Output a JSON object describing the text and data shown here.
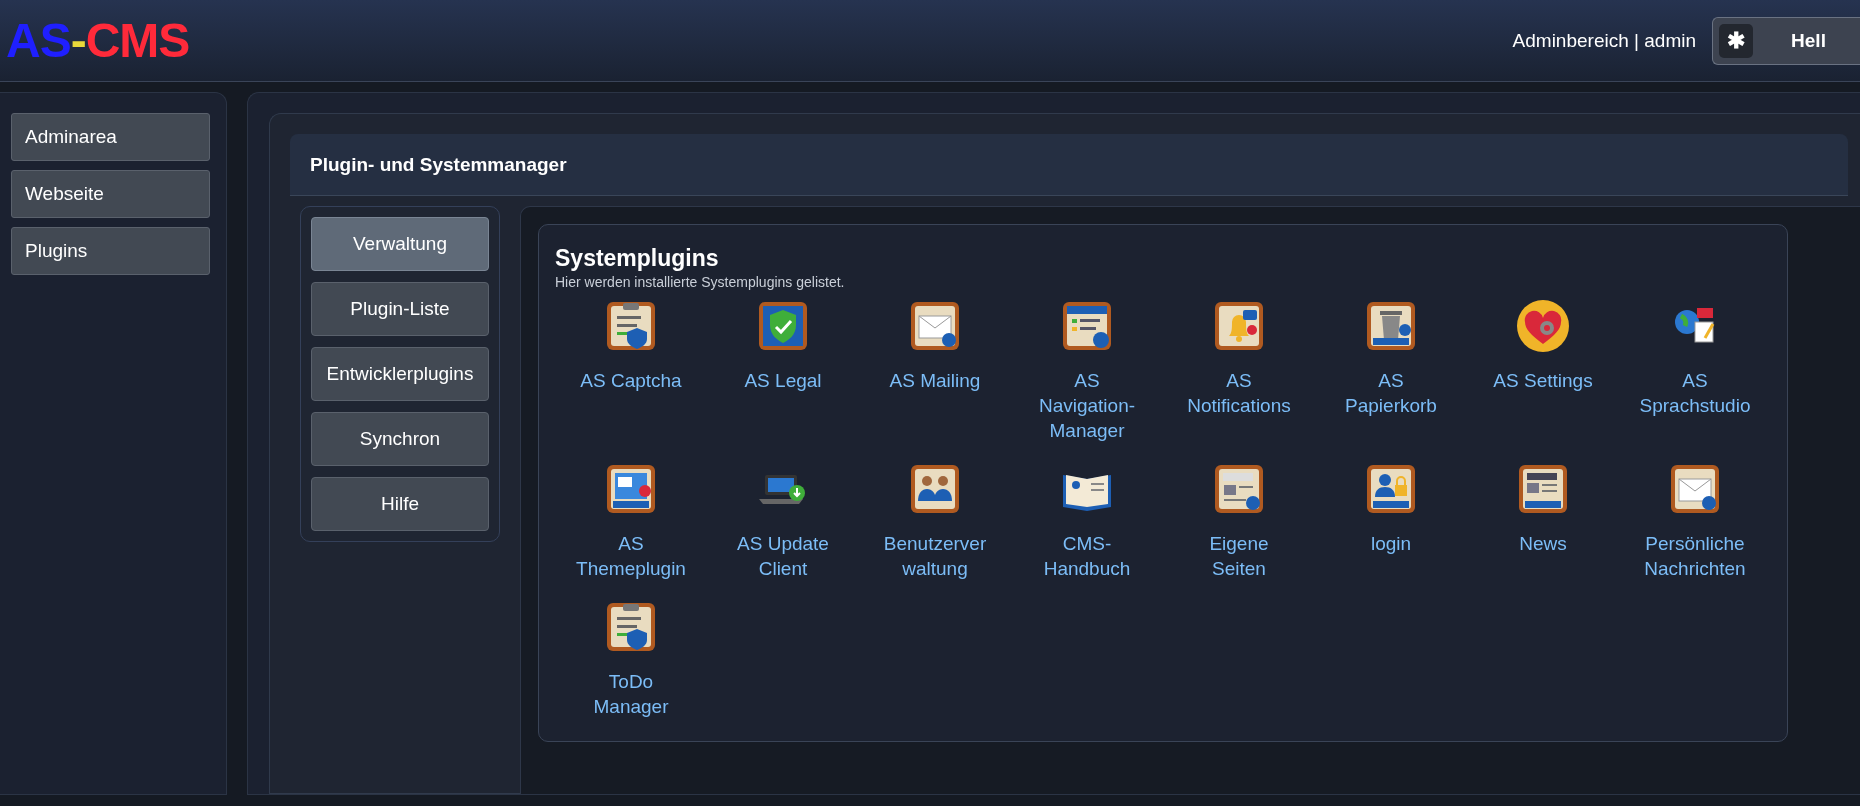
{
  "header": {
    "logo": [
      {
        "text": "AS",
        "color": "#1f1fff"
      },
      {
        "text": "-",
        "color": "#e8d83a"
      },
      {
        "text": "CMS",
        "color": "#ff2a3a"
      }
    ],
    "user_label": "Adminbereich | admin",
    "theme_toggle": {
      "icon": "✱",
      "label": "Hell"
    }
  },
  "sidebar": {
    "items": [
      {
        "label": "Adminarea"
      },
      {
        "label": "Webseite"
      },
      {
        "label": "Plugins"
      }
    ]
  },
  "manager": {
    "title": "Plugin- und Systemmanager",
    "menu": [
      {
        "label": "Verwaltung",
        "selected": true
      },
      {
        "label": "Plugin-Liste",
        "selected": false
      },
      {
        "label": "Entwicklerplugins",
        "selected": false
      },
      {
        "label": "Synchron",
        "selected": false
      },
      {
        "label": "Hilfe",
        "selected": false
      }
    ],
    "section": {
      "title": "Systemplugins",
      "subtitle": "Hier werden installierte Systemplugins gelistet.",
      "plugins": [
        {
          "name": "AS Captcha",
          "kind": "clipboard"
        },
        {
          "name": "AS Legal",
          "kind": "shield"
        },
        {
          "name": "AS Mailing",
          "kind": "envelope"
        },
        {
          "name": "AS Navigation-Manager",
          "kind": "list"
        },
        {
          "name": "AS Notifications",
          "kind": "bell"
        },
        {
          "name": "AS Papierkorb",
          "kind": "trash"
        },
        {
          "name": "AS Settings",
          "kind": "heart"
        },
        {
          "name": "AS Sprachstudio",
          "kind": "globe"
        },
        {
          "name": "AS Themeplugin",
          "kind": "window"
        },
        {
          "name": "AS Update Client",
          "kind": "laptop"
        },
        {
          "name": "Benutzerver waltung",
          "kind": "people"
        },
        {
          "name": "CMS-Handbuch",
          "kind": "book"
        },
        {
          "name": "Eigene Seiten",
          "kind": "document"
        },
        {
          "name": "login",
          "kind": "lock"
        },
        {
          "name": "News",
          "kind": "newspaper"
        },
        {
          "name": "Persönliche Nachrichten",
          "kind": "envelope"
        },
        {
          "name": "ToDo Manager",
          "kind": "clipboard"
        }
      ]
    }
  }
}
